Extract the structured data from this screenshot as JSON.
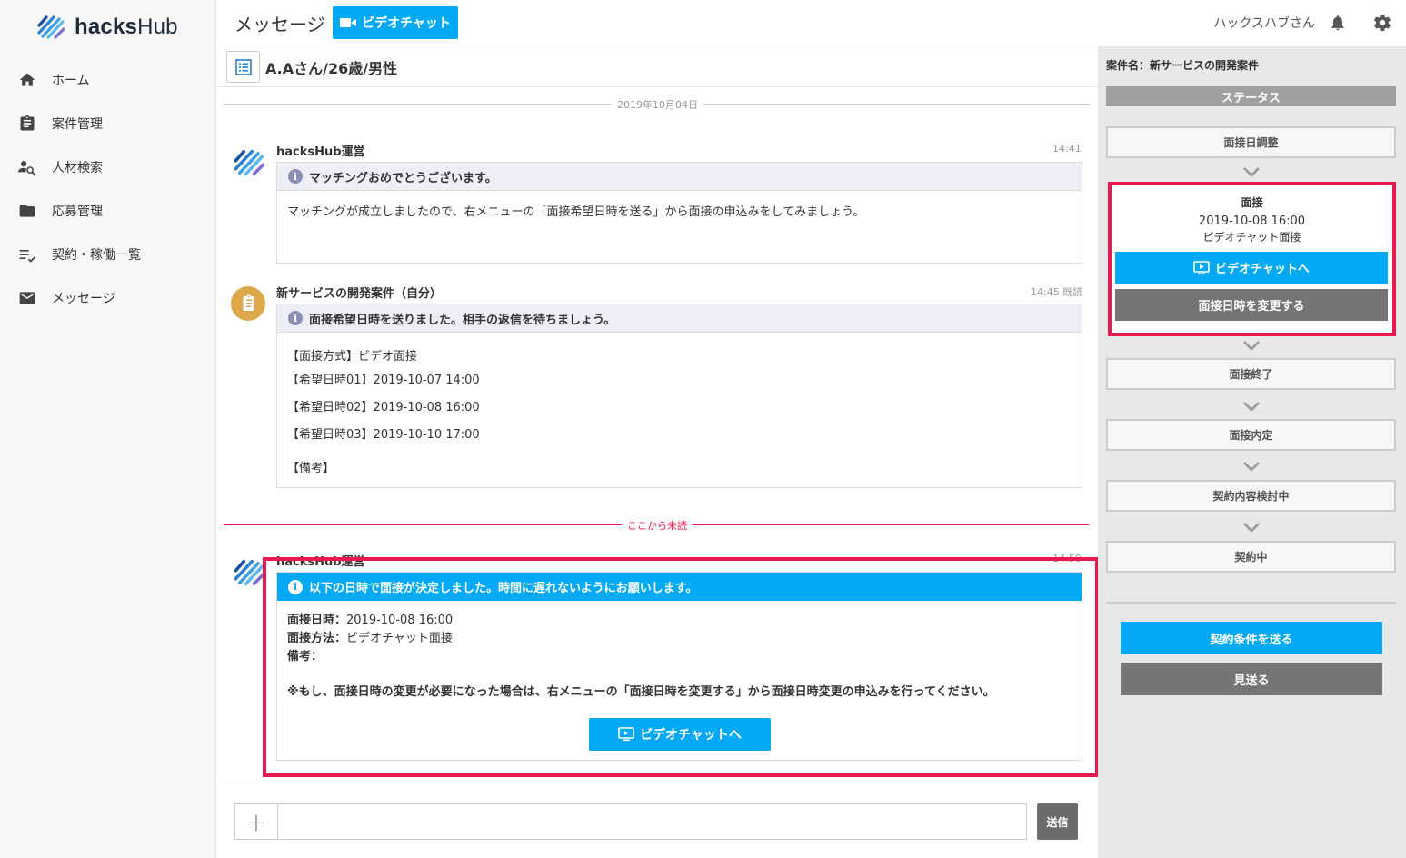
{
  "app": {
    "logo_text_bold": "hacks",
    "logo_text": "Hub"
  },
  "sidebar": {
    "items": [
      {
        "label": "ホーム",
        "icon": "home-icon"
      },
      {
        "label": "案件管理",
        "icon": "clipboard-icon"
      },
      {
        "label": "人材検索",
        "icon": "person-search-icon"
      },
      {
        "label": "応募管理",
        "icon": "folder-icon"
      },
      {
        "label": "契約・稼働一覧",
        "icon": "list-check-icon"
      },
      {
        "label": "メッセージ",
        "icon": "mail-icon"
      }
    ]
  },
  "header": {
    "title": "メッセージ",
    "video_button": "ビデオチャット",
    "user_name": "ハックスハブさん"
  },
  "chat": {
    "person": "A.Aさん/26歳/男性",
    "date_divider": "2019年10月04日",
    "unread_divider": "ここから未読",
    "messages": [
      {
        "sender": "hacksHub運営",
        "time": "14:41",
        "bar": "マッチングおめでとうございます。",
        "body": "マッチングが成立しましたので、右メニューの「面接希望日時を送る」から面接の申込みをしてみましょう。"
      },
      {
        "sender": "新サービスの開発案件（自分）",
        "time": "14:45 既読",
        "bar": "面接希望日時を送りました。相手の返信を待ちましょう。",
        "lines": [
          "【面接方式】ビデオ面接",
          "【希望日時01】2019-10-07 14:00",
          "【希望日時02】2019-10-08 16:00",
          "【希望日時03】2019-10-10 17:00",
          "【備考】"
        ]
      },
      {
        "sender": "hacksHub運営",
        "time": "14:50",
        "bar": "以下の日時で面接が決定しました。時間に遅れないようにお願いします。",
        "date_label": "面接日時：",
        "date_value": "2019-10-08 16:00",
        "method_label": "面接方法：",
        "method_value": "ビデオチャット面接",
        "note_label": "備考：",
        "notice": "※もし、面接日時の変更が必要になった場合は、右メニューの「面接日時を変更する」から面接日時変更の申込みを行ってください。",
        "button": "ビデオチャットへ"
      }
    ]
  },
  "input": {
    "send_label": "送信",
    "plus": "+"
  },
  "right_panel": {
    "project_name": "案件名：新サービスの開発案件",
    "status_title": "ステータス",
    "steps": [
      "面接日調整",
      "面接終了",
      "面接内定",
      "契約内容検討中",
      "契約中"
    ],
    "active": {
      "title": "面接",
      "date": "2019-10-08 16:00",
      "method": "ビデオチャット面接",
      "video_button": "ビデオチャットへ",
      "change_button": "面接日時を変更する"
    },
    "send_contract_button": "契約条件を送る",
    "pass_button": "見送る"
  },
  "colors": {
    "accent": "#03a9f4",
    "highlight": "#e8194e",
    "gray_button": "#757575"
  }
}
